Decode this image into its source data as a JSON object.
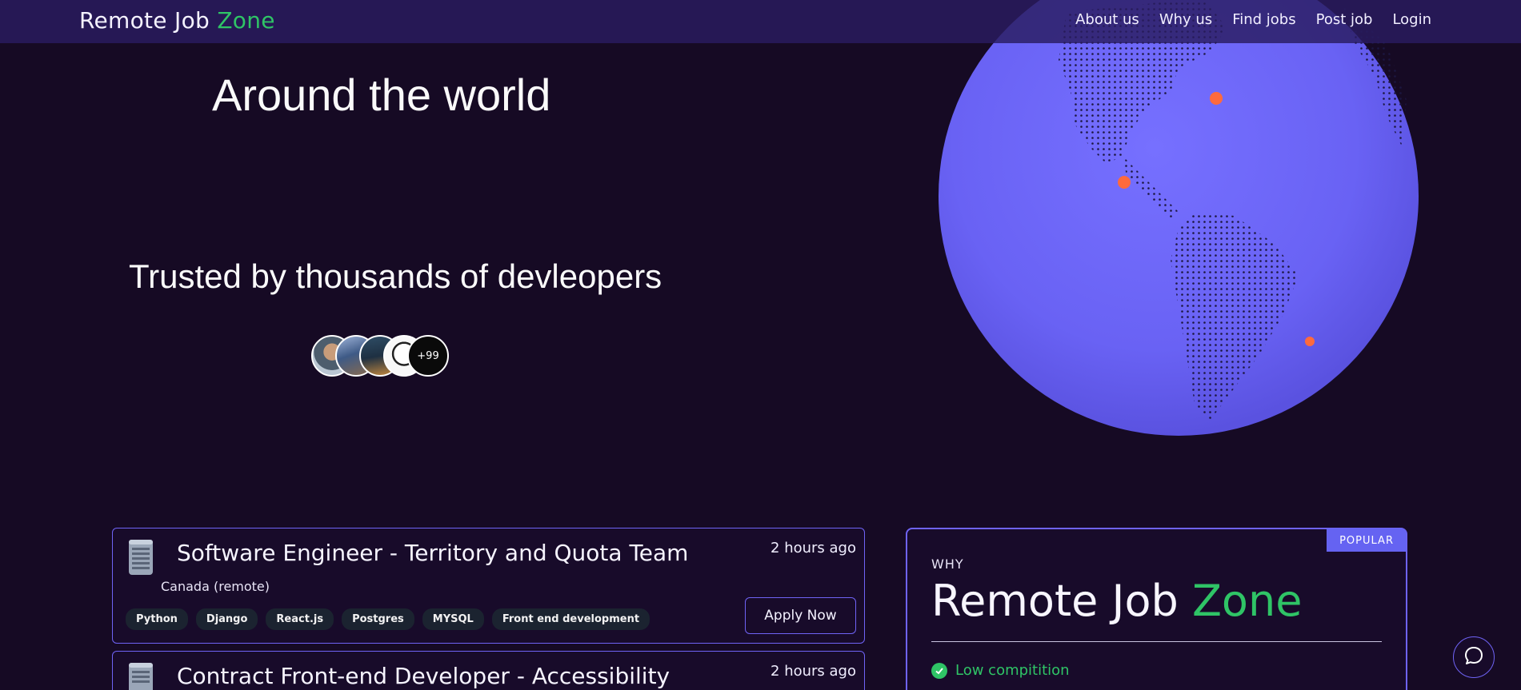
{
  "brand": {
    "main": "Remote Job ",
    "accent": "Zone"
  },
  "nav": {
    "links": [
      "About us",
      "Why us",
      "Find jobs",
      "Post job",
      "Login"
    ]
  },
  "hero": {
    "title": "Around the world",
    "trusted": "Trusted by thousands of devleopers",
    "more_count": "+99"
  },
  "colors": {
    "background": "#160a24",
    "navbar": "#2a1c60",
    "accent_green": "#2fc466",
    "accent_purple": "#6f63f5",
    "globe": "#6b63f4"
  },
  "jobs": [
    {
      "title": "Software Engineer - Territory and Quota Team",
      "time": "2 hours ago",
      "location": "Canada (remote)",
      "tags": [
        "Python",
        "Django",
        "React.js",
        "Postgres",
        "MYSQL",
        "Front end development"
      ],
      "apply_label": "Apply Now",
      "icon": "building-icon"
    },
    {
      "title": "Contract Front-end Developer - Accessibility",
      "time": "2 hours ago",
      "icon": "building-icon"
    }
  ],
  "why": {
    "badge": "POPULAR",
    "label": "WHY",
    "title_main": "Remote Job ",
    "title_accent": "Zone",
    "items": [
      "Low compitition"
    ]
  },
  "chat": {
    "icon": "chat-bubble-icon"
  }
}
